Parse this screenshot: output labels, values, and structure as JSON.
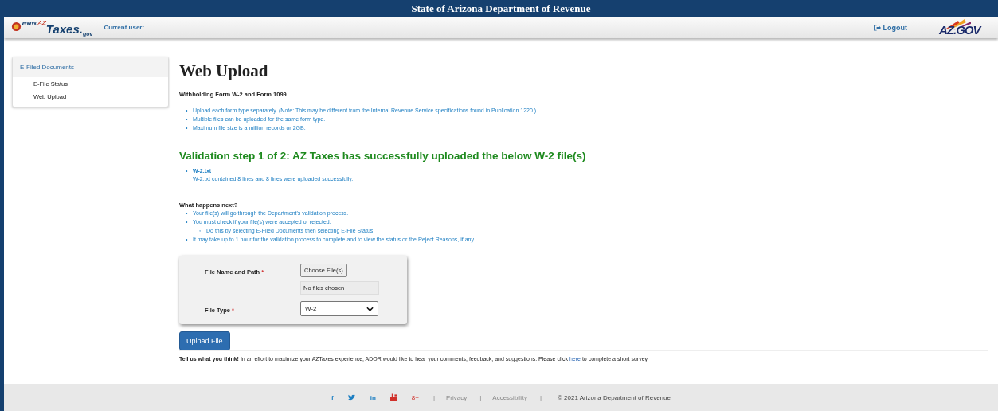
{
  "window": {
    "title": "State of Arizona Department of Revenue"
  },
  "header": {
    "logo_prefix": "www.",
    "logo_az": "AZ",
    "logo_main": "Taxes.",
    "logo_suffix": "gov",
    "current_user_label": "Current user:",
    "logout": "Logout",
    "state_logo": "AZ.GOV"
  },
  "sidebar": {
    "title": "E-Filed Documents",
    "items": [
      {
        "label": "E-File Status"
      },
      {
        "label": "Web Upload"
      }
    ]
  },
  "page": {
    "title": "Web Upload",
    "subtitle": "Withholding Form W-2 and Form 1099",
    "bullets": [
      "Upload each form type separately. (Note: This may be different from the Internal Revenue Service specifications found in Publication 1220.)",
      "Multiple files can be uploaded for the same form type.",
      "Maximum file size is a million records or 2GB."
    ],
    "success_heading": "Validation step 1 of 2: AZ Taxes has successfully uploaded the below W-2 file(s)",
    "files": [
      {
        "name": "W-2.txt",
        "message": "W-2.txt contained 8 lines and 8 lines were uploaded successfully."
      }
    ],
    "next_heading": "What happens next?",
    "bullet": "•",
    "sub_bullet": "◦",
    "next_steps": [
      {
        "text": "Your file(s) will go through the Department's validation process."
      },
      {
        "text": "You must check if your file(s) were accepted or rejected.",
        "children": [
          {
            "text": "Do this by selecting E-Filed Documents then selecting E-File Status"
          }
        ]
      },
      {
        "text": "It may take up to 1 hour for the validation process to complete and to view the status or the Reject Reasons, if any."
      }
    ]
  },
  "form": {
    "file_label": "File Name and Path",
    "required_mark": "*",
    "choose_button": "Choose File(s)",
    "file_status": "No files chosen",
    "type_label": "File Type",
    "type_value": "W-2",
    "submit": "Upload File"
  },
  "survey": {
    "lead": "Tell us what you think!",
    "text": " In an effort to maximize your AZTaxes experience, ADOR would like to hear your comments, feedback, and suggestions. Please click ",
    "link": "here",
    "tail": " to complete a short survey."
  },
  "footer": {
    "social": [
      {
        "kind": "facebook",
        "glyph": "f"
      },
      {
        "kind": "twitter"
      },
      {
        "kind": "linkedin",
        "glyph": "in"
      },
      {
        "kind": "youtube"
      },
      {
        "kind": "googleplus",
        "glyph": "8+"
      }
    ],
    "separator": "|",
    "links": [
      "Privacy",
      "Accessibility"
    ],
    "copyright": "©  2021 Arizona Department of Revenue"
  }
}
